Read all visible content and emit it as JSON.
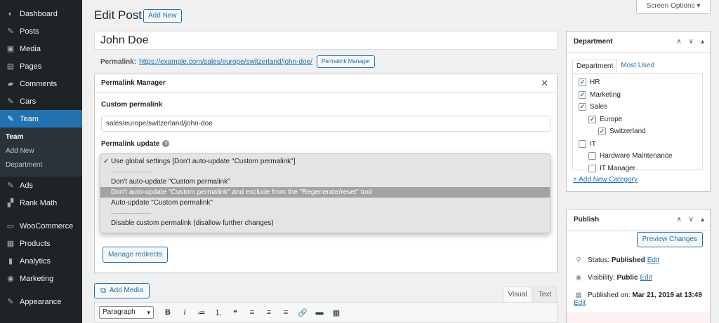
{
  "sidebar": {
    "items": [
      {
        "label": "Dashboard",
        "icon": "dashboard-icon",
        "glyph": "◐"
      },
      {
        "label": "Posts",
        "icon": "pin-icon",
        "glyph": "✎"
      },
      {
        "label": "Media",
        "icon": "media-icon",
        "glyph": "▣"
      },
      {
        "label": "Pages",
        "icon": "pages-icon",
        "glyph": "▤"
      },
      {
        "label": "Comments",
        "icon": "comments-icon",
        "glyph": "▰"
      },
      {
        "label": "Cars",
        "icon": "pin-icon",
        "glyph": "✎"
      },
      {
        "label": "Team",
        "icon": "pin-icon",
        "glyph": "✎"
      }
    ],
    "submenu": [
      "Team",
      "Add New",
      "Department"
    ],
    "items2": [
      {
        "label": "Ads",
        "icon": "pin-icon",
        "glyph": "✎"
      },
      {
        "label": "Rank Math",
        "icon": "rankmath-icon",
        "glyph": "▞"
      }
    ],
    "items3": [
      {
        "label": "WooCommerce",
        "icon": "woocommerce-icon",
        "glyph": "▭"
      },
      {
        "label": "Products",
        "icon": "products-icon",
        "glyph": "▦"
      },
      {
        "label": "Analytics",
        "icon": "analytics-icon",
        "glyph": "▮"
      },
      {
        "label": "Marketing",
        "icon": "marketing-icon",
        "glyph": "◉"
      }
    ],
    "items4": [
      {
        "label": "Appearance",
        "icon": "appearance-icon",
        "glyph": "✎"
      }
    ]
  },
  "header": {
    "title": "Edit Post",
    "add_new": "Add New",
    "screen_options": "Screen Options ▾"
  },
  "post": {
    "title": "John Doe",
    "permalink_label": "Permalink:",
    "permalink_url": "https://example.com/sales/europe/switzerland/john-doe/",
    "permalink_manager_button": "Permalink Manager"
  },
  "pm": {
    "title": "Permalink Manager",
    "close": "✕",
    "custom_label": "Custom permalink",
    "custom_value": "sales/europe/switzerland/john-doe",
    "update_label": "Permalink update",
    "options": [
      "Use global settings [Don't auto-update \"Custom permalink\"]",
      "-------------------",
      "Don't auto-update \"Custom permalink\"",
      "Don't auto-update \"Custom permalink\" and exclude from the \"Regenerate/reset\" tool",
      "Auto-update \"Custom permalink\"",
      "-------------------",
      "Disable custom permalink (disallow further changes)"
    ],
    "manage_redirects": "Manage redirects"
  },
  "editor": {
    "add_media": "Add Media",
    "tab_visual": "Visual",
    "tab_text": "Text",
    "format": "Paragraph",
    "tools": [
      "B",
      "I",
      "≔",
      "⒈",
      "❝",
      "≡",
      "≡",
      "≡",
      "🔗",
      "▬",
      "▦"
    ]
  },
  "department": {
    "title": "Department",
    "tab_all": "Department",
    "tab_used": "Most Used",
    "cats": [
      {
        "label": "HR",
        "checked": true,
        "level": 0
      },
      {
        "label": "Marketing",
        "checked": true,
        "level": 0
      },
      {
        "label": "Sales",
        "checked": true,
        "level": 0
      },
      {
        "label": "Europe",
        "checked": true,
        "level": 1
      },
      {
        "label": "Switzerland",
        "checked": true,
        "level": 2
      },
      {
        "label": "IT",
        "checked": false,
        "level": 0
      },
      {
        "label": "Hardware Maintenance",
        "checked": false,
        "level": 1
      },
      {
        "label": "IT Manager",
        "checked": false,
        "level": 1
      }
    ],
    "add_category": "+ Add New Category"
  },
  "publish": {
    "title": "Publish",
    "preview": "Preview Changes",
    "status_label": "Status:",
    "status_value": "Published",
    "visibility_label": "Visibility:",
    "visibility_value": "Public",
    "published_label": "Published on:",
    "published_value": "Mar 21, 2019 at 13:49",
    "edit": "Edit"
  },
  "colors": {
    "sidebar": "#1d2327",
    "accent": "#2271b1",
    "highlight": "#a3a3a3"
  }
}
